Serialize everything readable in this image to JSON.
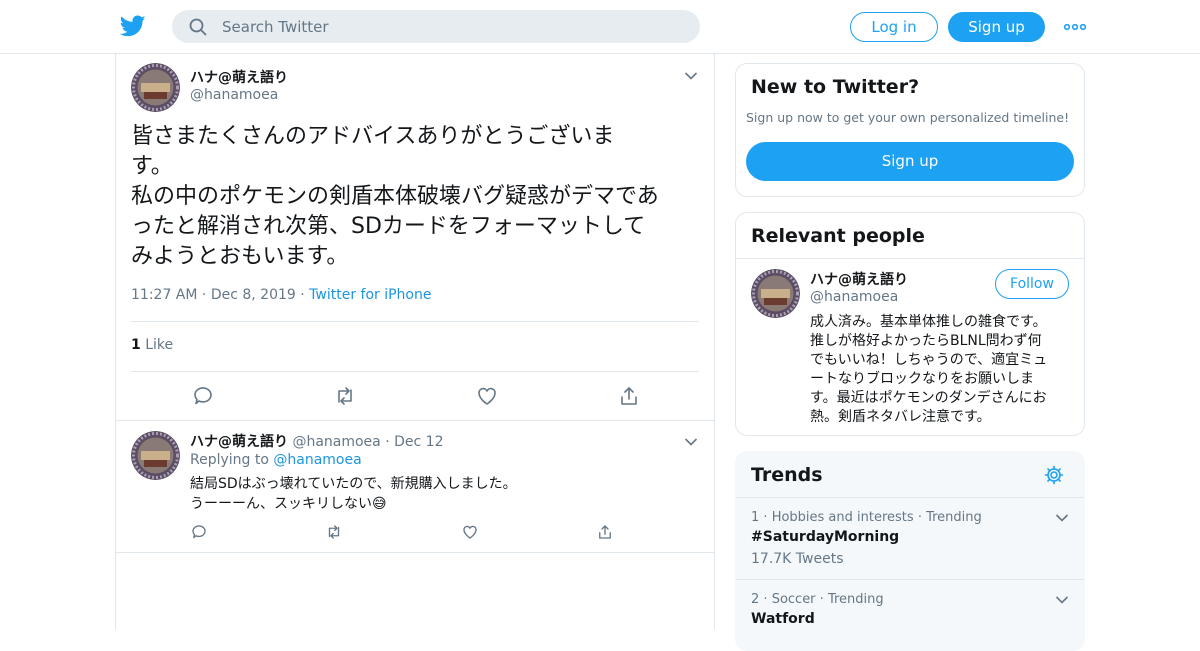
{
  "header": {
    "search_placeholder": "Search Twitter",
    "login_label": "Log in",
    "signup_label": "Sign up",
    "brand_color": "#1da1f2",
    "logo_icon": "twitter-bird-icon",
    "more_icon": "more-dots-icon"
  },
  "tweet": {
    "author_name": "ハナ@萌え語り",
    "author_handle": "@hanamoea",
    "text_lines": [
      "皆さまたくさんのアドバイスありがとうございま",
      "す。",
      "私の中のポケモンの剣盾本体破壊バグ疑惑がデマであ",
      "ったと解消され次第、SDカードをフォーマットして",
      "みようとおもいます。"
    ],
    "time": "11:27 AM",
    "date": "Dec 8, 2019",
    "source": "Twitter for iPhone",
    "like_count": "1",
    "like_label": "Like"
  },
  "reply": {
    "author_name": "ハナ@萌え語り",
    "author_handle": "@hanamoea",
    "date": "Dec 12",
    "replying_to_label": "Replying to",
    "replying_to_handle": "@hanamoea",
    "text_line1": "結局SDはぶっ壊れていたので、新規購入しました。",
    "text_line2": "うーーーん、スッキリしない",
    "emoji": "😅"
  },
  "new_to_twitter": {
    "title": "New to Twitter?",
    "subtitle": "Sign up now to get your own personalized timeline!",
    "signup_label": "Sign up"
  },
  "relevant_people": {
    "title": "Relevant people",
    "name": "ハナ@萌え語り",
    "handle": "@hanamoea",
    "follow_label": "Follow",
    "bio_lines": [
      "成人済み。基本単体推しの雑食です。",
      "推しが格好よかったらBLNL問わず何",
      "でもいいね！しちゃうので、適宜ミュ",
      "ートなりブロックなりをお願いしま",
      "す。最近はポケモンのダンデさんにお",
      "熱。剣盾ネタバレ注意です。"
    ]
  },
  "trends": {
    "title": "Trends",
    "items": [
      {
        "rank": "1",
        "context": "Hobbies and interests",
        "status": "Trending",
        "name": "#SaturdayMorning",
        "count": "17.7K Tweets"
      },
      {
        "rank": "2",
        "context": "Soccer",
        "status": "Trending",
        "name": "Watford",
        "count": ""
      }
    ]
  }
}
